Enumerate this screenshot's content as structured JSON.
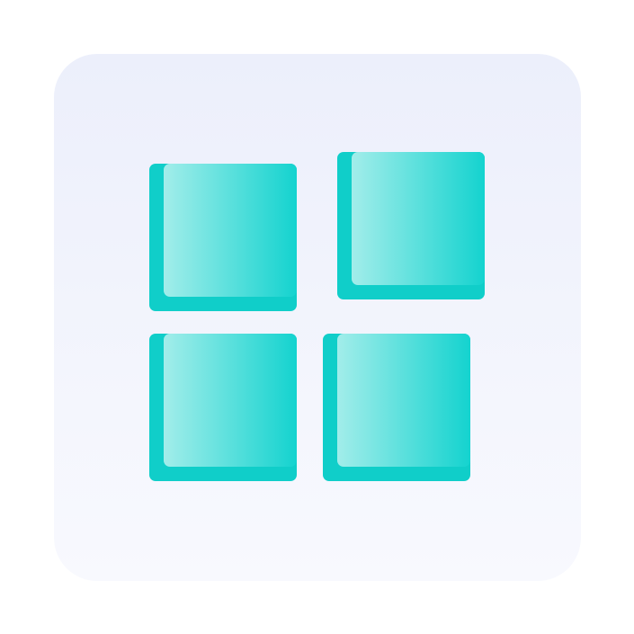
{
  "icon": {
    "name": "grid-icon",
    "tile_gradient": [
      "#ECEFFB",
      "#F8F9FE"
    ],
    "square_shadow_color": "#10CEC9",
    "square_gradient": [
      "#A2EDEA",
      "#14D3CF"
    ]
  }
}
